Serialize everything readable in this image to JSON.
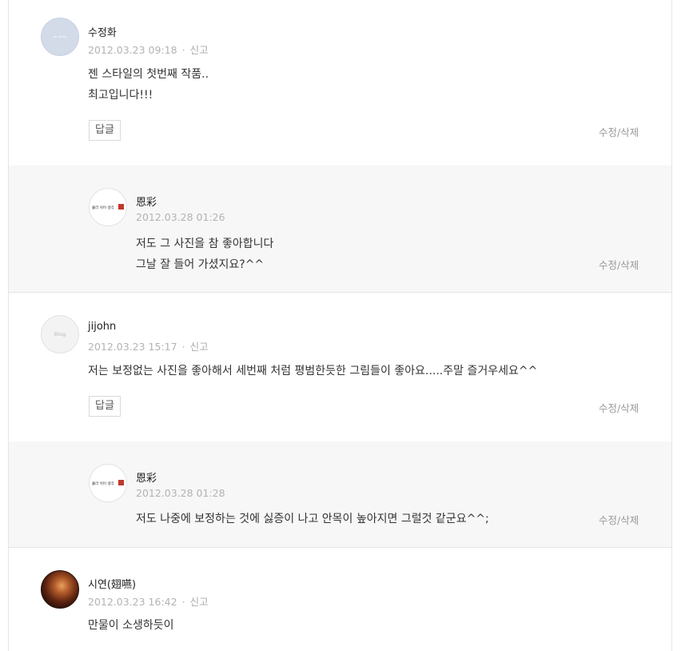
{
  "comments": [
    {
      "author": "수정화",
      "date": "2012.03.23 09:18",
      "report": "신고",
      "lines": [
        "젠 스타일의 첫번째 작품..",
        "최고입니다!!!"
      ],
      "reply_label": "답글",
      "edit_label": "수정/삭제",
      "avatar_text": "NO IMAGE",
      "replies": [
        {
          "author": "恩彩",
          "date": "2012.03.28 01:26",
          "lines": [
            "저도 그 사진을 참 좋아합니다",
            "그날 잘 들어 가셨지요?^^"
          ],
          "edit_label": "수정/삭제",
          "avatar_text": "흘러 쉬어 생각"
        }
      ]
    },
    {
      "author": "jijohn",
      "date": "2012.03.23 15:17",
      "report": "신고",
      "lines": [
        "저는 보정없는 사진을 좋아해서 세번째 처럼 평범한듯한 그림들이 좋아요.....주말 즐거우세요^^"
      ],
      "reply_label": "답글",
      "edit_label": "수정/삭제",
      "avatar_text": "Blog",
      "replies": [
        {
          "author": "恩彩",
          "date": "2012.03.28 01:28",
          "lines": [
            "저도 나중에 보정하는 것에 싫증이 나고 안목이 높아지면 그럴것 같군요^^;"
          ],
          "edit_label": "수정/삭제",
          "avatar_text": "흘러 쉬어 생각"
        }
      ]
    },
    {
      "author": "시연(翅嚥)",
      "date": "2012.03.23 16:42",
      "report": "신고",
      "lines": [
        "만물이 소생하듯이"
      ]
    }
  ],
  "colors": {
    "reply_bg": "#f7f7f7",
    "meta": "#b3b3b3",
    "seal_red": "#c0392b"
  }
}
